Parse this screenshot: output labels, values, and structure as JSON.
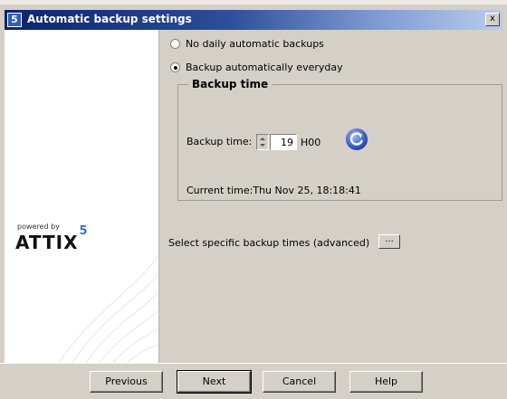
{
  "window": {
    "title": "Automatic backup settings",
    "close_label": "x",
    "app_icon_label": "5"
  },
  "brand": {
    "powered_by": "powered by",
    "logo_text": "ATTIX",
    "logo_sup": "5"
  },
  "options": [
    {
      "label": "No daily automatic backups",
      "selected": false
    },
    {
      "label": "Backup automatically everyday",
      "selected": true
    }
  ],
  "backup_time_group": {
    "title": "Backup time",
    "time_label": "Backup time:",
    "hour_value": "19",
    "hour_suffix": "H00",
    "current_time": "Current time:Thu Nov 25, 18:18:41"
  },
  "advanced": {
    "label": "Select specific backup times (advanced)",
    "button_label": "..."
  },
  "buttons": {
    "previous": "Previous",
    "next": "Next",
    "cancel": "Cancel",
    "help": "Help"
  },
  "colors": {
    "titlebar_start": "#0a246a",
    "titlebar_end": "#b9ccea",
    "face": "#d4d0c8",
    "logo_accent": "#3a6fd0"
  }
}
